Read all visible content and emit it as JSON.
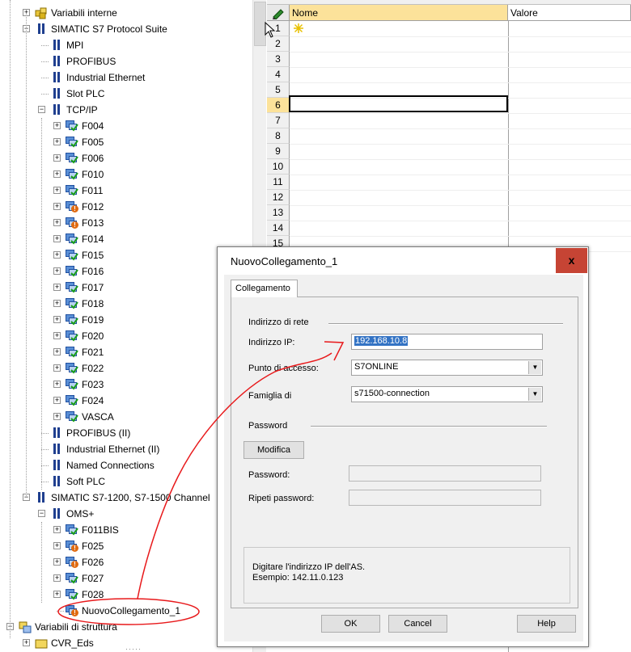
{
  "tree": {
    "items": [
      {
        "label": "Variabili interne",
        "icon": "folder-cube-icon"
      },
      {
        "label": "SIMATIC S7 Protocol Suite",
        "icon": "channel-icon"
      },
      {
        "label": "MPI",
        "icon": "channel-icon"
      },
      {
        "label": "PROFIBUS",
        "icon": "channel-icon"
      },
      {
        "label": "Industrial Ethernet",
        "icon": "channel-icon"
      },
      {
        "label": "Slot PLC",
        "icon": "channel-icon"
      },
      {
        "label": "TCP/IP",
        "icon": "channel-icon"
      },
      {
        "label": "F004",
        "icon": "connection-ok-icon"
      },
      {
        "label": "F005",
        "icon": "connection-ok-icon"
      },
      {
        "label": "F006",
        "icon": "connection-ok-icon"
      },
      {
        "label": "F010",
        "icon": "connection-ok-icon"
      },
      {
        "label": "F011",
        "icon": "connection-ok-icon"
      },
      {
        "label": "F012",
        "icon": "connection-warning-icon"
      },
      {
        "label": "F013",
        "icon": "connection-warning-icon"
      },
      {
        "label": "F014",
        "icon": "connection-ok-icon"
      },
      {
        "label": "F015",
        "icon": "connection-ok-icon"
      },
      {
        "label": "F016",
        "icon": "connection-ok-icon"
      },
      {
        "label": "F017",
        "icon": "connection-ok-icon"
      },
      {
        "label": "F018",
        "icon": "connection-ok-icon"
      },
      {
        "label": "F019",
        "icon": "connection-ok-icon"
      },
      {
        "label": "F020",
        "icon": "connection-ok-icon"
      },
      {
        "label": "F021",
        "icon": "connection-ok-icon"
      },
      {
        "label": "F022",
        "icon": "connection-ok-icon"
      },
      {
        "label": "F023",
        "icon": "connection-ok-icon"
      },
      {
        "label": "F024",
        "icon": "connection-ok-icon"
      },
      {
        "label": "VASCA",
        "icon": "connection-ok-icon"
      },
      {
        "label": "PROFIBUS (II)",
        "icon": "channel-icon"
      },
      {
        "label": "Industrial Ethernet (II)",
        "icon": "channel-icon"
      },
      {
        "label": "Named Connections",
        "icon": "channel-icon"
      },
      {
        "label": "Soft PLC",
        "icon": "channel-icon"
      },
      {
        "label": "SIMATIC S7-1200, S7-1500 Channel",
        "icon": "channel-icon"
      },
      {
        "label": "OMS+",
        "icon": "channel-icon"
      },
      {
        "label": "F011BIS",
        "icon": "connection-ok-icon"
      },
      {
        "label": "F025",
        "icon": "connection-warning-icon"
      },
      {
        "label": "F026",
        "icon": "connection-warning-icon"
      },
      {
        "label": "F027",
        "icon": "connection-ok-icon"
      },
      {
        "label": "F028",
        "icon": "connection-ok-icon"
      },
      {
        "label": "NuovoCollegamento_1",
        "icon": "connection-warning-icon"
      },
      {
        "label": "Variabili di struttura",
        "icon": "structure-icon"
      },
      {
        "label": "CVR_Eds",
        "icon": "folder-icon"
      }
    ]
  },
  "grid": {
    "columns": [
      "Nome",
      "Valore"
    ],
    "rows": [
      "1",
      "2",
      "3",
      "4",
      "5",
      "6",
      "7",
      "8",
      "9",
      "10",
      "11",
      "12",
      "13",
      "14",
      "15"
    ],
    "selected_row": "6",
    "new_row_icon": "new-row-star-icon"
  },
  "dialog": {
    "title": "NuovoCollegamento_1",
    "close_label": "x",
    "tab": "Collegamento",
    "section_network": "Indirizzo di rete",
    "ip_label": "Indirizzo IP:",
    "ip_value": "192.168.10.8",
    "access_label": "Punto di accesso:",
    "access_value": "S7ONLINE",
    "family_label": "Famiglia di",
    "family_value": "s71500-connection",
    "section_password": "Password",
    "modify_button": "Modifica",
    "password_label": "Password:",
    "repeat_password_label": "Ripeti password:",
    "hint_line1": "Digitare l'indirizzo IP dell'AS.",
    "hint_line2": "Esempio: 142.11.0.123",
    "ok_button": "OK",
    "cancel_button": "Cancel",
    "help_button": "Help"
  },
  "colors": {
    "header_highlight": "#fce29a",
    "close_button": "#c64434",
    "annotation": "#e8191b",
    "selection": "#3373c4"
  }
}
